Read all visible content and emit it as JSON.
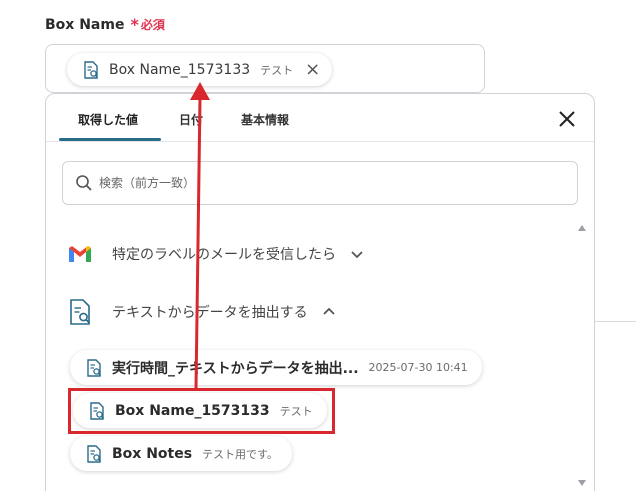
{
  "field": {
    "label": "Box Name",
    "required_mark": "*",
    "required_text": "必須"
  },
  "input_chip": {
    "label": "Box Name_1573133",
    "sub": "テスト",
    "close": "×"
  },
  "panel": {
    "tabs": [
      "取得した値",
      "日付",
      "基本情報"
    ],
    "active_tab": "取得した値",
    "search_placeholder": "検索（前方一致）"
  },
  "sections": [
    {
      "label": "特定のラベルのメールを受信したら",
      "icon": "gmail-icon",
      "expanded": false
    },
    {
      "label": "テキストからデータを抽出する",
      "icon": "document-search-icon",
      "expanded": true
    }
  ],
  "items": [
    {
      "label": "実行時間_テキストからデータを抽出...",
      "sub": "2025-07-30 10:41"
    },
    {
      "label": "Box Name_1573133",
      "sub": "テスト"
    },
    {
      "label": "Box Notes",
      "sub": "テスト用です。"
    }
  ],
  "colors": {
    "accent": "#2a6b8a",
    "required": "#e0344f",
    "annotation": "#d9272e"
  }
}
